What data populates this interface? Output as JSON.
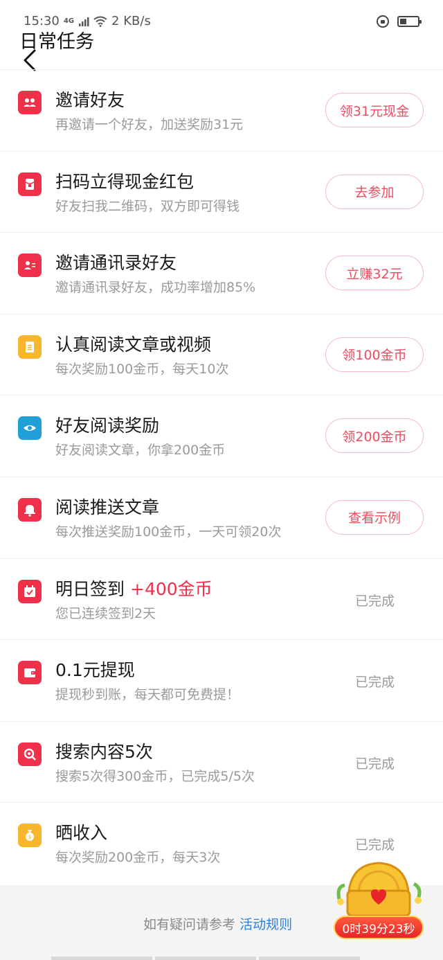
{
  "status_bar": {
    "time": "15:30",
    "network": "4G",
    "speed": "2 KB/s"
  },
  "header": {
    "title": "日常任务"
  },
  "tasks": [
    {
      "title": "邀请好友",
      "bonus": "",
      "desc": "再邀请一个好友，加送奖励31元",
      "action": "领31元现金",
      "done": "",
      "icon": "friends-icon",
      "icon_color": "#f0304a"
    },
    {
      "title": "扫码立得现金红包",
      "bonus": "",
      "desc": "好友扫我二维码，双方即可得钱",
      "action": "去参加",
      "done": "",
      "icon": "red-envelope-icon",
      "icon_color": "#f0304a"
    },
    {
      "title": "邀请通讯录好友",
      "bonus": "",
      "desc": "邀请通讯录好友，成功率增加85%",
      "action": "立赚32元",
      "done": "",
      "icon": "contact-card-icon",
      "icon_color": "#f0304a"
    },
    {
      "title": "认真阅读文章或视频",
      "bonus": "",
      "desc": "每次奖励100金币，每天10次",
      "action": "领100金币",
      "done": "",
      "icon": "document-icon",
      "icon_color": "#f7b62c"
    },
    {
      "title": "好友阅读奖励",
      "bonus": "",
      "desc": "好友阅读文章，你拿200金币",
      "action": "领200金币",
      "done": "",
      "icon": "eye-icon",
      "icon_color": "#21a0d8"
    },
    {
      "title": "阅读推送文章",
      "bonus": "",
      "desc": "每次推送奖励100金币，一天可领20次",
      "action": "查看示例",
      "done": "",
      "icon": "bell-icon",
      "icon_color": "#f0304a"
    },
    {
      "title": "明日签到",
      "bonus": "+400金币",
      "desc": "您已连续签到2天",
      "action": "",
      "done": "已完成",
      "icon": "calendar-check-icon",
      "icon_color": "#f0304a"
    },
    {
      "title": "0.1元提现",
      "bonus": "",
      "desc": "提现秒到账，每天都可免费提！",
      "action": "",
      "done": "已完成",
      "icon": "wallet-icon",
      "icon_color": "#f0304a"
    },
    {
      "title": "搜索内容5次",
      "bonus": "",
      "desc": "搜索5次得300金币，已完成5/5次",
      "action": "",
      "done": "已完成",
      "icon": "search-icon",
      "icon_color": "#f0304a"
    },
    {
      "title": "晒收入",
      "bonus": "",
      "desc": "每次奖励200金币，每天3次",
      "action": "",
      "done": "已完成",
      "icon": "money-bag-icon",
      "icon_color": "#f7b62c"
    }
  ],
  "footer": {
    "help_text": "如有疑问请参考",
    "rules_link": "活动规则"
  },
  "treasure": {
    "timer": "0时39分23秒"
  }
}
